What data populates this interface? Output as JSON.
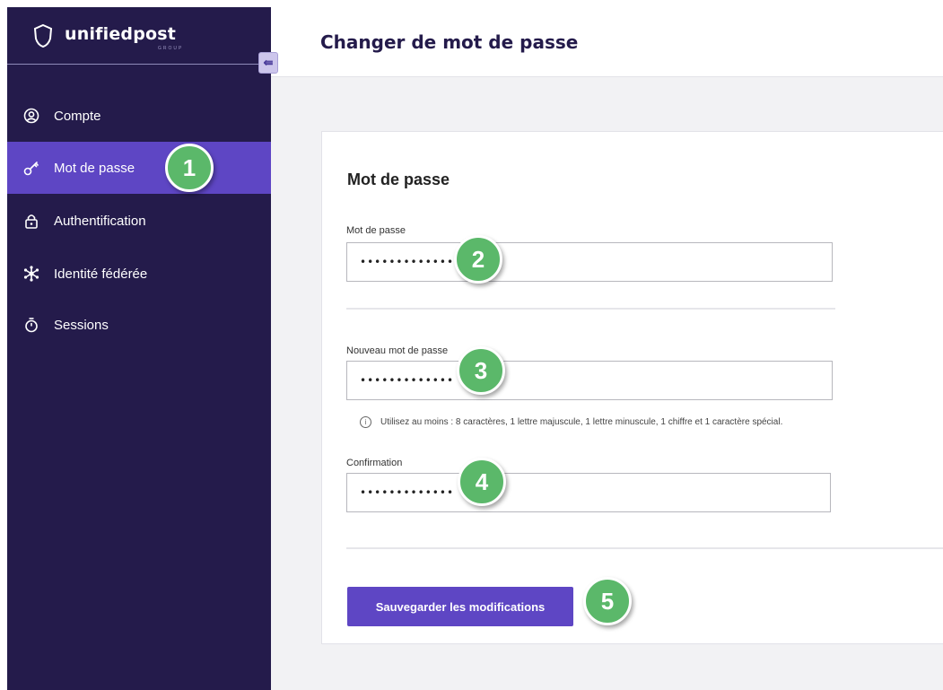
{
  "brand": {
    "name": "unifiedpost",
    "tagline": "GROUP",
    "icon": "shield-outline-icon"
  },
  "collapse_icon": "⇚",
  "sidebar": {
    "items": [
      {
        "label": "Compte",
        "icon": "user-circle-icon",
        "active": false
      },
      {
        "label": "Mot de passe",
        "icon": "key-icon",
        "active": true
      },
      {
        "label": "Authentification",
        "icon": "padlock-icon",
        "active": false
      },
      {
        "label": "Identité fédérée",
        "icon": "network-icon",
        "active": false
      },
      {
        "label": "Sessions",
        "icon": "stopwatch-icon",
        "active": false
      }
    ]
  },
  "header": {
    "title": "Changer de mot de passe"
  },
  "form": {
    "title": "Mot de passe",
    "current": {
      "label": "Mot de passe",
      "value": "•••••••••••••"
    },
    "new": {
      "label": "Nouveau mot de passe",
      "value": "•••••••••••••"
    },
    "hint": "Utilisez au moins : 8 caractères, 1 lettre majuscule, 1 lettre minuscule, 1 chiffre et 1 caractère spécial.",
    "hint_icon": "i",
    "confirm": {
      "label": "Confirmation",
      "value": "•••••••••••••"
    },
    "save_label": "Sauvegarder les modifications"
  },
  "steps": [
    "1",
    "2",
    "3",
    "4",
    "5"
  ],
  "colors": {
    "sidebar": "#241b4b",
    "accent": "#5e46c4",
    "step": "#5bb86a"
  }
}
